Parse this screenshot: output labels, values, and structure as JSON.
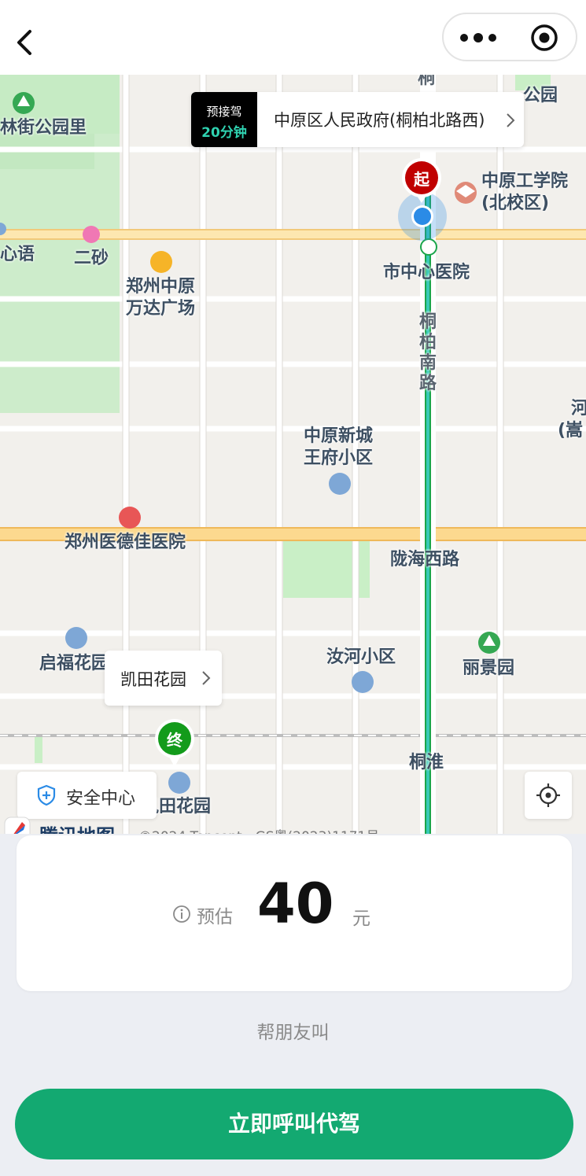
{
  "map": {
    "pickup_badge_line1": "预接驾",
    "pickup_badge_line2": "20分钟",
    "pickup_address": "中原区人民政府(桐柏北路西)",
    "start_marker": "起",
    "destination_label": "凯田花园",
    "end_marker": "终",
    "safety_center": "安全中心",
    "logo_text": "腾讯地图",
    "copyright": "©2024 Tencent - GS粤(2023)1171号",
    "pois": {
      "park_top_left": "林街公园里",
      "park_top_right": "公园",
      "xinyu": "心语",
      "ersha": "二砂",
      "wanda_line1": "郑州中原",
      "wanda_line2": "万达广场",
      "school_line1": "中原工学院",
      "school_line2": "(北校区)",
      "hospital_city": "市中心医院",
      "road_tongbai": "桐柏南路",
      "road_top": "桐",
      "wangfu_line1": "中原新城",
      "wangfu_line2": "王府小区",
      "hospital_dejia": "郑州医德佳医院",
      "longhai": "陇海西路",
      "he_line1": "河",
      "he_line2": "(嵩",
      "qifu": "启福花园",
      "ruhe": "汝河小区",
      "lijing": "丽景园",
      "tonghuai": "桐淮",
      "kaitian_partial": "凯田花园"
    }
  },
  "fare": {
    "label": "预估",
    "amount": "40",
    "unit": "元"
  },
  "friend_link": "帮朋友叫",
  "call_button": "立即呼叫代驾",
  "colors": {
    "brand_green": "#13a971",
    "start_red": "#c00000",
    "end_green": "#139b1b",
    "location_blue": "#2b8be6"
  }
}
